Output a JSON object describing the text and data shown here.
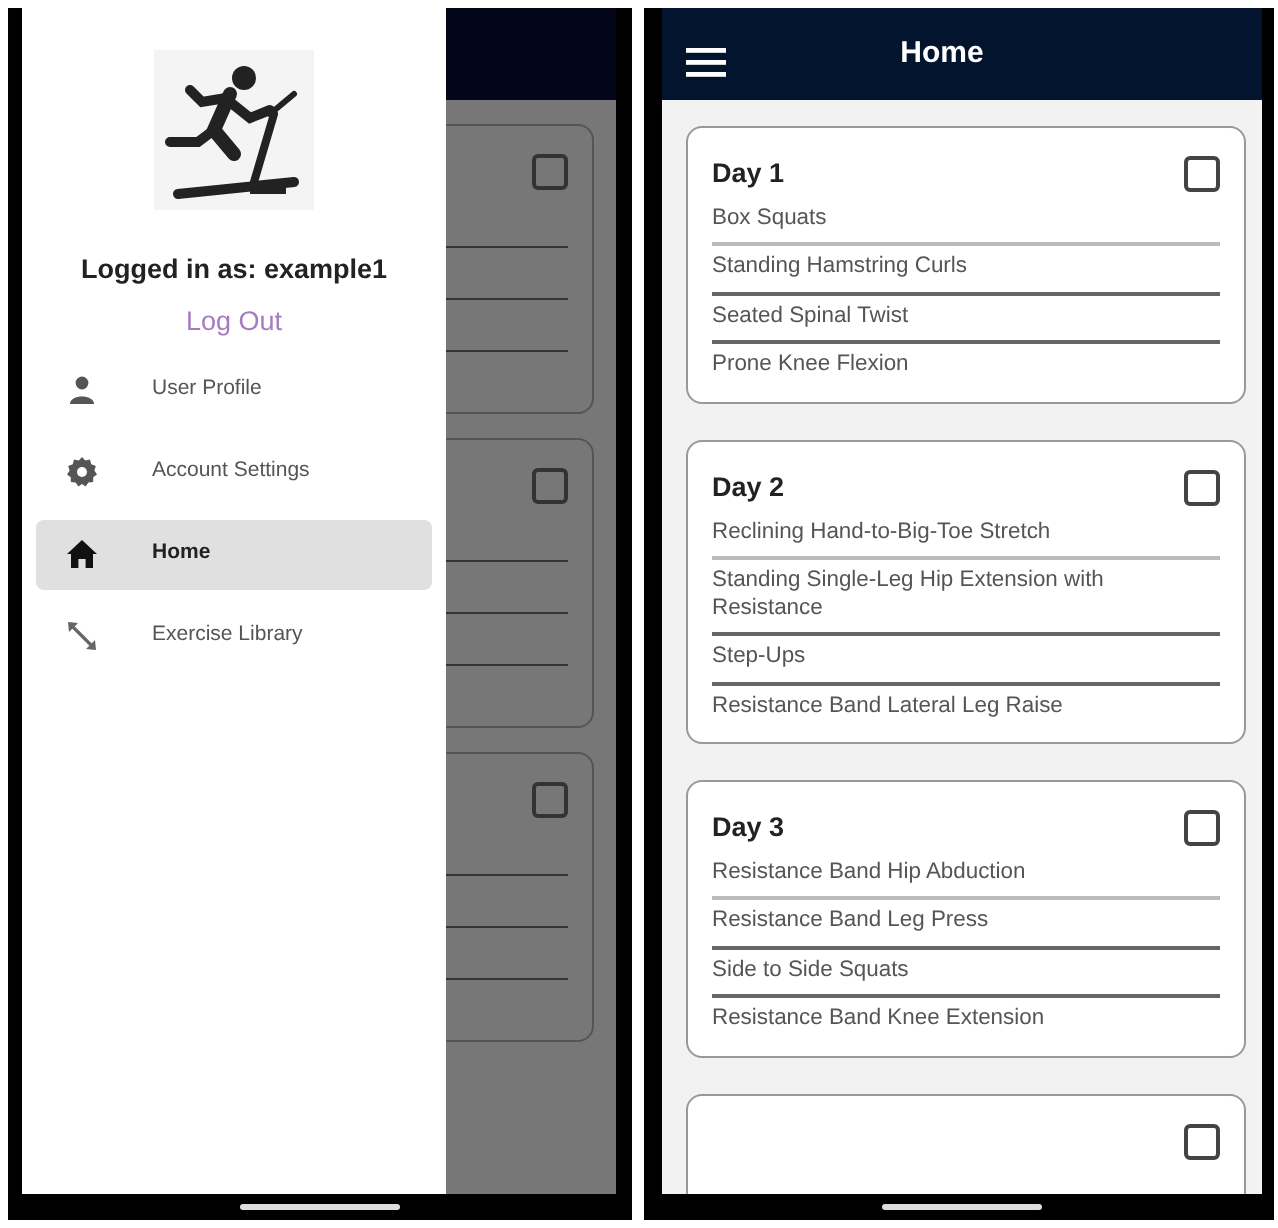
{
  "drawer": {
    "user_label": "Logged in as: example1",
    "logout": "Log Out",
    "menu": [
      {
        "label": "User Profile",
        "selected": false
      },
      {
        "label": "Account Settings",
        "selected": false
      },
      {
        "label": "Home",
        "selected": true
      },
      {
        "label": "Exercise Library",
        "selected": false
      }
    ]
  },
  "background_screen": {
    "cards": [
      {
        "checked": false
      },
      {
        "checked": false
      },
      {
        "checked": false
      }
    ]
  },
  "app": {
    "title": "Home",
    "days": [
      {
        "title": "Day 1",
        "checked": false,
        "exercises": [
          "Box Squats",
          "Standing Hamstring Curls",
          "Seated Spinal Twist",
          "Prone Knee Flexion"
        ]
      },
      {
        "title": "Day 2",
        "checked": false,
        "exercises": [
          "Reclining Hand-to-Big-Toe Stretch",
          "Standing Single-Leg Hip Extension with Resistance",
          "Step-Ups",
          "Resistance Band Lateral Leg Raise"
        ]
      },
      {
        "title": "Day 3",
        "checked": false,
        "exercises": [
          "Resistance Band Hip Abduction",
          "Resistance Band Leg Press",
          "Side to Side Squats",
          "Resistance Band Knee Extension"
        ]
      },
      {
        "checked": false
      }
    ]
  }
}
